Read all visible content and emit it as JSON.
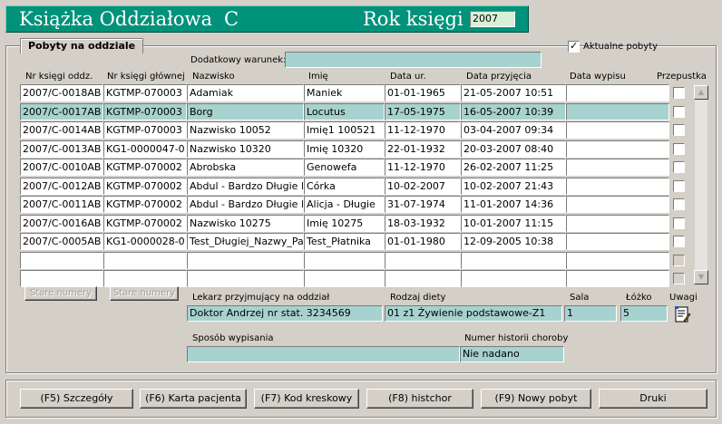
{
  "header": {
    "title": "Książka Oddziałowa",
    "section": "C",
    "year_label": "Rok księgi",
    "year_value": "2007"
  },
  "tab": {
    "label": "Pobyty na oddziale"
  },
  "filter": {
    "label": "Dodatkowy warunek:",
    "value": ""
  },
  "current_stays": {
    "label": "Aktualne pobyty",
    "checked": true
  },
  "table": {
    "columns": [
      "Nr księgi oddz.",
      "Nr księgi głównej",
      "Nazwisko",
      "Imię",
      "Data ur.",
      "Data przyjęcia",
      "Data wypisu",
      "Przepustka"
    ],
    "rows": [
      [
        "2007/C-0018AB",
        "KGTMP-070003",
        "Adamiak",
        "Maniek",
        "01-01-1965",
        "21-05-2007 10:51",
        ""
      ],
      [
        "2007/C-0017AB",
        "KGTMP-070003",
        "Borg",
        "Locutus",
        "17-05-1975",
        "16-05-2007 10:39",
        ""
      ],
      [
        "2007/C-0014AB",
        "KGTMP-070003",
        "Nazwisko 10052",
        "Imię1 100521",
        "11-12-1970",
        "03-04-2007 09:34",
        ""
      ],
      [
        "2007/C-0013AB",
        "KG1-0000047-0",
        "Nazwisko 10320",
        "Imię 10320",
        "22-01-1932",
        "20-03-2007 08:40",
        ""
      ],
      [
        "2007/C-0010AB",
        "KGTMP-070002",
        "Abrobska",
        "Genowefa",
        "11-12-1970",
        "26-02-2007 11:25",
        ""
      ],
      [
        "2007/C-0012AB",
        "KGTMP-070002",
        "Abdul - Bardzo Długie N",
        "Córka",
        "10-02-2007",
        "10-02-2007 21:43",
        ""
      ],
      [
        "2007/C-0011AB",
        "KGTMP-070002",
        "Abdul - Bardzo Długie N",
        "Alicja - Długie",
        "31-07-1974",
        "11-01-2007 14:36",
        ""
      ],
      [
        "2007/C-0016AB",
        "KGTMP-070002",
        "Nazwisko 10275",
        "Imię 10275",
        "18-03-1932",
        "10-01-2007 11:15",
        ""
      ],
      [
        "2007/C-0005AB",
        "KG1-0000028-0",
        "Test_Długiej_Nazwy_Pa",
        "Test_Płatnika",
        "01-01-1980",
        "12-09-2005 10:38",
        ""
      ],
      [
        "",
        "",
        "",
        "",
        "",
        "",
        ""
      ],
      [
        "",
        "",
        "",
        "",
        "",
        "",
        ""
      ]
    ],
    "selected_row": 1
  },
  "old_numbers_buttons": [
    "Stare numery",
    "Stare numery"
  ],
  "details": {
    "doctor_label": "Lekarz przyjmujący na oddział",
    "doctor_value": "Doktor Andrzej nr stat. 3234569",
    "diet_label": "Rodzaj diety",
    "diet_value": "01 z1 Żywienie podstawowe-Z1",
    "room_label": "Sala",
    "room_value": "1",
    "bed_label": "Łóżko",
    "bed_value": "5",
    "notes_label": "Uwagi",
    "discharge_label": "Sposób wypisania",
    "discharge_value": "",
    "history_label": "Numer historii choroby",
    "history_value": "Nie nadano"
  },
  "buttons": {
    "details": "(F5) Szczegóły",
    "patient_card": "(F6) Karta pacjenta",
    "barcode": "(F7) Kod kreskowy",
    "histchor": "(F8) histchor",
    "new_stay": "(F9) Nowy pobyt",
    "print": "Druki"
  },
  "colors": {
    "header_bg": "#00927a",
    "field_bg": "#a6d2d0",
    "window_bg": "#d4d0c8"
  }
}
